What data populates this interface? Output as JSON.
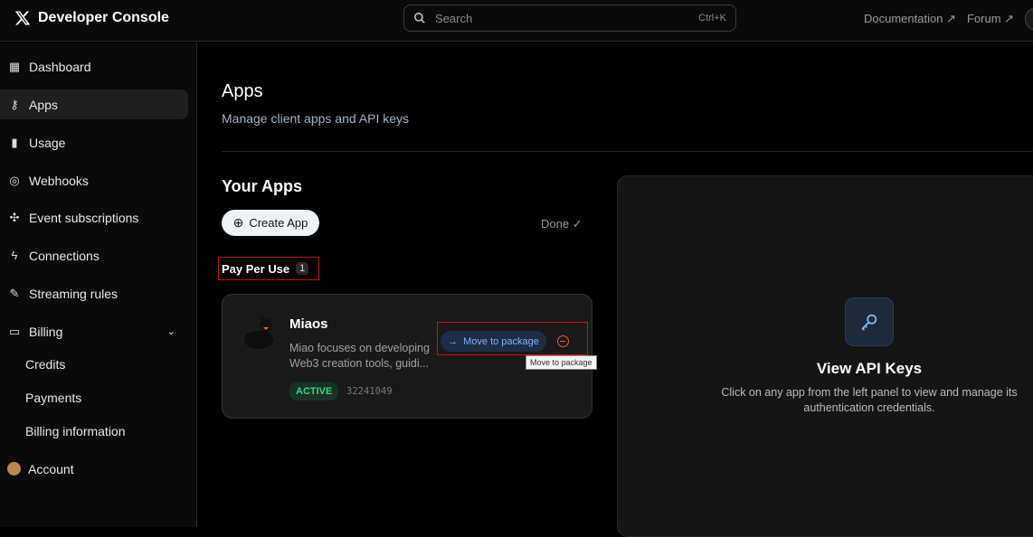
{
  "header": {
    "title": "Developer Console",
    "search_placeholder": "Search",
    "search_shortcut": "Ctrl+K",
    "links": [
      "Documentation ↗",
      "Forum ↗"
    ]
  },
  "sidebar": {
    "items": [
      {
        "label": "Dashboard",
        "icon": "grid-icon"
      },
      {
        "label": "Apps",
        "icon": "key-icon"
      },
      {
        "label": "Usage",
        "icon": "bar-chart-icon"
      },
      {
        "label": "Webhooks",
        "icon": "webhook-icon"
      },
      {
        "label": "Event subscriptions",
        "icon": "network-icon"
      },
      {
        "label": "Connections",
        "icon": "bolt-icon"
      },
      {
        "label": "Streaming rules",
        "icon": "pencil-icon"
      },
      {
        "label": "Billing",
        "icon": "card-icon"
      }
    ],
    "billing_sub": [
      "Credits",
      "Payments",
      "Billing information"
    ],
    "account": "Account"
  },
  "main": {
    "title": "Apps",
    "subtitle": "Manage client apps and API keys",
    "your_apps": "Your Apps",
    "create_label": "Create App",
    "done_label": "Done ✓",
    "group": {
      "name": "Pay Per Use",
      "count": "1"
    },
    "app": {
      "name": "Miaos",
      "description": "Miao focuses on developing Web3 creation tools, guidi...",
      "status": "ACTIVE",
      "id": "32241049",
      "move_label": "Move to package",
      "tooltip": "Move to package"
    }
  },
  "panel": {
    "title": "View API Keys",
    "description": "Click on any app from the left panel to view and manage its authentication credentials."
  }
}
